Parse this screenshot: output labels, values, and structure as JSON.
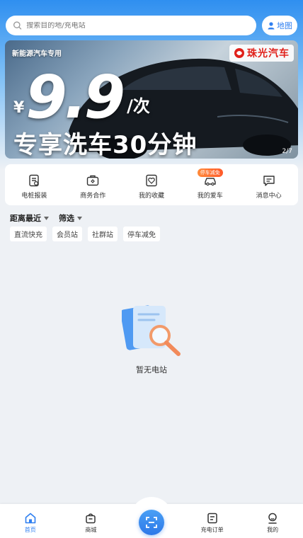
{
  "search": {
    "placeholder": "搜索目的地/充电站"
  },
  "map_button": {
    "label": "地图"
  },
  "banner": {
    "tag": "新能源汽车专用",
    "brand": "珠光汽车",
    "currency": "¥",
    "price": "9.9",
    "unit": "/次",
    "title": "专享洗车30分钟",
    "page_indicator": "2/7"
  },
  "quick_menu": [
    {
      "label": "电桩报装",
      "icon": "report-icon"
    },
    {
      "label": "商务合作",
      "icon": "briefcase-icon"
    },
    {
      "label": "我的收藏",
      "icon": "favorite-icon"
    },
    {
      "label": "我的爱车",
      "icon": "car-icon",
      "badge": "停车减免"
    },
    {
      "label": "消息中心",
      "icon": "message-icon"
    }
  ],
  "filters": [
    {
      "label": "距离最近"
    },
    {
      "label": "筛选"
    }
  ],
  "tags": [
    "直流快充",
    "会员站",
    "社群站",
    "停车减免"
  ],
  "empty": {
    "text": "暂无电站"
  },
  "tabbar": [
    {
      "label": "首页",
      "icon": "home-icon",
      "active": true
    },
    {
      "label": "商城",
      "icon": "shop-icon"
    },
    {
      "label": "充电订单",
      "icon": "order-icon"
    },
    {
      "label": "我的",
      "icon": "profile-icon"
    }
  ],
  "colors": {
    "primary": "#2f7ff0",
    "badge": "#ff6a2a",
    "brand_red": "#e0201a"
  }
}
